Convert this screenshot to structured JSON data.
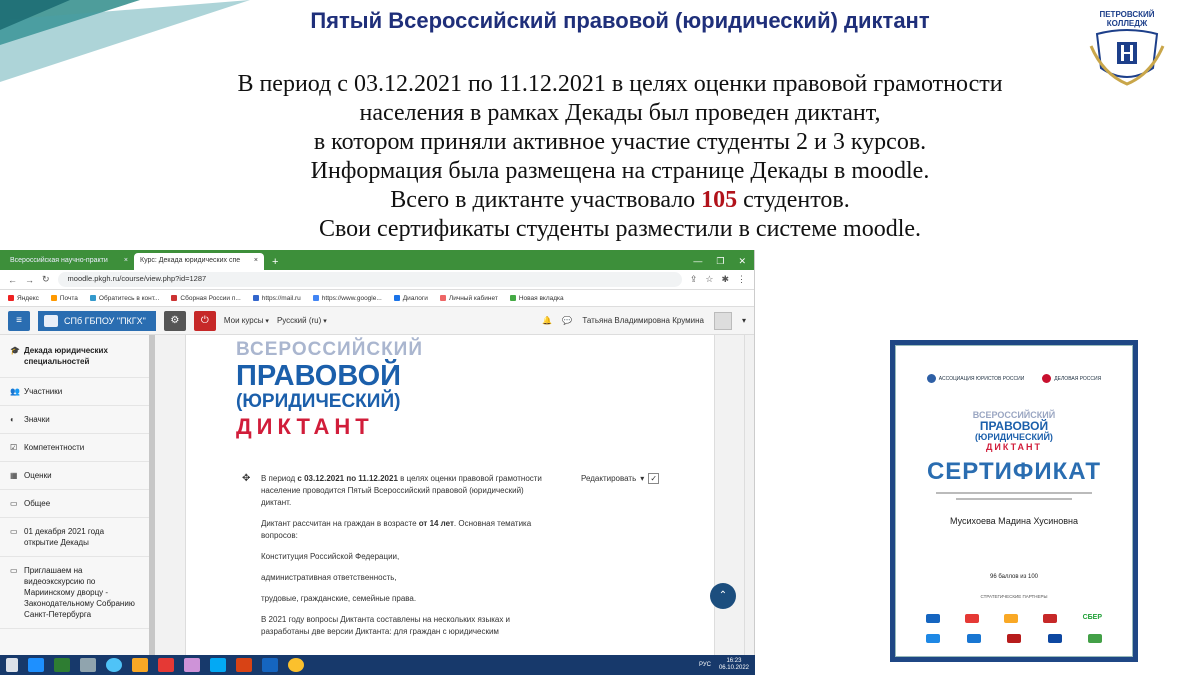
{
  "slide": {
    "title": "Пятый Всероссийский правовой (юридический) диктант",
    "lines": [
      "В период с 03.12.2021 по 11.12.2021 в целях оценки правовой грамотности",
      "населения в рамках Декады был проведен диктант,",
      "в котором приняли активное участие студенты 2 и 3 курсов.",
      "Информация была размещена на странице Декады в moodle."
    ],
    "count_prefix": "Всего в диктанте участвовало",
    "count_value": "105",
    "count_suffix": "студентов.",
    "last_line": "Свои сертификаты студенты разместили в системе moodle.",
    "colors": {
      "title": "#1f2f7a",
      "highlight": "#b1121a",
      "accent": "#3d8f3a"
    }
  },
  "logo": {
    "line1": "ПЕТРОВСКИЙ",
    "line2": "КОЛЛЕДЖ"
  },
  "browser": {
    "tabs": [
      {
        "label": "Всероссийская научно-практи",
        "close": "×"
      },
      {
        "label": "Курс: Декада юридических спе",
        "close": "×"
      }
    ],
    "new_tab": "+",
    "url": "moodle.pkgh.ru/course/view.php?id=1287",
    "bookmarks": [
      "Яндекс",
      "Почта",
      "Обратитесь в конт...",
      "Сборная России п...",
      "https://mail.ru",
      "https://www.google...",
      "Диалоги",
      "Личный кабинет",
      "Новая вкладка"
    ],
    "moodle": {
      "site_name": "СПб ГБПОУ \"ПКГХ\"",
      "my_courses": "Мои курсы",
      "language": "Русский (ru)",
      "user_name": "Татьяна Владимировна Крумина"
    },
    "sidebar": [
      {
        "icon": "graduation-cap-icon",
        "label": "Декада юридических специальностей"
      },
      {
        "icon": "users-icon",
        "label": "Участники"
      },
      {
        "icon": "shield-icon",
        "label": "Значки"
      },
      {
        "icon": "checkbox-icon",
        "label": "Компетентности"
      },
      {
        "icon": "grid-icon",
        "label": "Оценки"
      },
      {
        "icon": "folder-icon",
        "label": "Общее"
      },
      {
        "icon": "folder-icon",
        "label": "01 декабря 2021 года открытие Декады"
      },
      {
        "icon": "folder-icon",
        "label": "Приглашаем на видеоэкскурсию по Мариинскому дворцу - Законодательному Собранию Санкт-Петербурга"
      }
    ],
    "banner": {
      "line1": "ВСЕРОССИЙСКИЙ",
      "line2": "ПРАВОВОЙ",
      "line3": "(ЮРИДИЧЕСКИЙ)",
      "line4": "ДИКТАНТ"
    },
    "edit_label": "Редактировать",
    "content": {
      "p1_a": "В период ",
      "p1_b": "с 03.12.2021 по 11.12.2021",
      "p1_c": " в целях оценки правовой грамотности население проводится Пятый Всероссийский правовой (юридический) диктант.",
      "p2_a": "Диктант рассчитан на граждан в возрасте ",
      "p2_b": "от 14  лет",
      "p2_c": ". Основная тематика вопросов:",
      "p3": "Конституция Российской Федерации,",
      "p4": "административная ответственность,",
      "p5": "трудовые, гражданские, семейные права.",
      "p6": "В 2021 году вопросы Диктанта составлены на нескольких языках и разработаны две  версии Диктанта: для граждан с юридическим"
    }
  },
  "taskbar": {
    "lang": "РУС",
    "time": "16:23",
    "date": "06.10.2022"
  },
  "certificate": {
    "partner1": "АССОЦИАЦИЯ ЮРИСТОВ РОССИИ",
    "partner2": "ДЕЛОВАЯ РОССИЯ",
    "line1": "ВСЕРОССИЙСКИЙ",
    "line2": "ПРАВОВОЙ",
    "line3": "(ЮРИДИЧЕСКИЙ)",
    "line4": "ДИКТАНТ",
    "title": "СЕРТИФИКАТ",
    "name": "Мусихоева Мадина Хусиновна",
    "score": "96 баллов из 100",
    "partners_label": "СТРАТЕГИЧЕСКИЕ ПАРТНЕРЫ",
    "sber": "СБЕР"
  }
}
